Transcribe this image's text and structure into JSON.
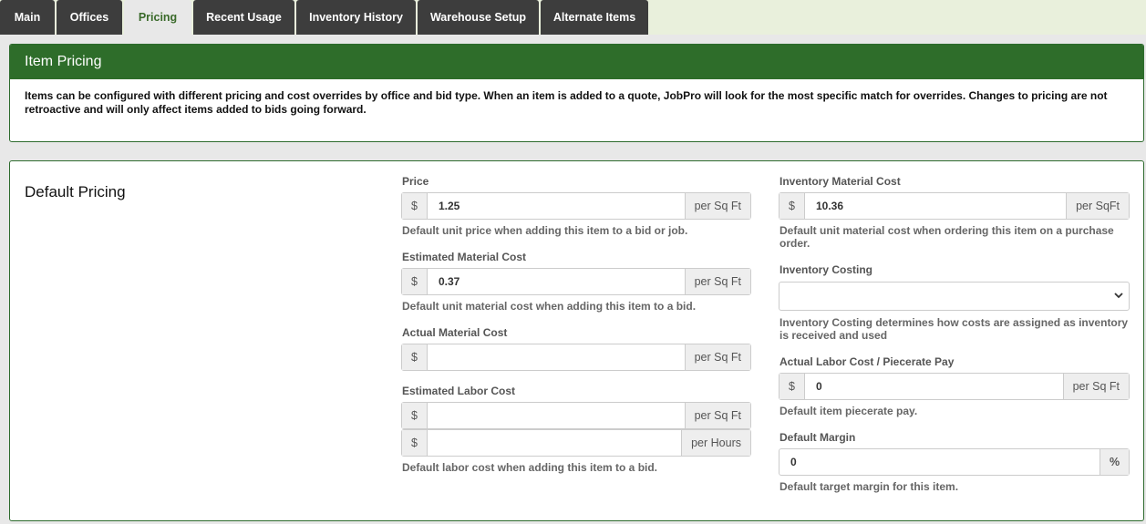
{
  "tabs": [
    {
      "label": "Main",
      "active": false
    },
    {
      "label": "Offices",
      "active": false
    },
    {
      "label": "Pricing",
      "active": true
    },
    {
      "label": "Recent Usage",
      "active": false
    },
    {
      "label": "Inventory History",
      "active": false
    },
    {
      "label": "Warehouse Setup",
      "active": false
    },
    {
      "label": "Alternate Items",
      "active": false
    }
  ],
  "item_pricing": {
    "title": "Item Pricing",
    "description": "Items can be configured with different pricing and cost overrides by office and bid type. When an item is added to a quote, JobPro will look for the most specific match for overrides. Changes to pricing are not retroactive and will only affect items added to bids going forward."
  },
  "default_pricing": {
    "title": "Default Pricing",
    "price": {
      "label": "Price",
      "prefix": "$",
      "value": "1.25",
      "unit": "per Sq Ft",
      "help": "Default unit price when adding this item to a bid or job."
    },
    "est_material": {
      "label": "Estimated Material Cost",
      "prefix": "$",
      "value": "0.37",
      "unit": "per Sq Ft",
      "help": "Default unit material cost when adding this item to a bid."
    },
    "act_material": {
      "label": "Actual Material Cost",
      "prefix": "$",
      "value": "",
      "unit": "per Sq Ft"
    },
    "est_labor": {
      "label": "Estimated Labor Cost",
      "prefix": "$",
      "value_sqft": "",
      "unit_sqft": "per Sq Ft",
      "value_hours": "",
      "unit_hours": "per Hours",
      "help": "Default labor cost when adding this item to a bid."
    },
    "inv_material": {
      "label": "Inventory Material Cost",
      "prefix": "$",
      "value": "10.36",
      "unit": "per SqFt",
      "help": "Default unit material cost when ordering this item on a purchase order."
    },
    "inv_costing": {
      "label": "Inventory Costing",
      "value": "",
      "help": "Inventory Costing determines how costs are assigned as inventory is received and used"
    },
    "labor_pay": {
      "label": "Actual Labor Cost / Piecerate Pay",
      "prefix": "$",
      "value": "0",
      "unit": "per Sq Ft",
      "help": "Default item piecerate pay."
    },
    "margin": {
      "label": "Default Margin",
      "value": "0",
      "unit": "%",
      "help": "Default target margin for this item."
    }
  }
}
